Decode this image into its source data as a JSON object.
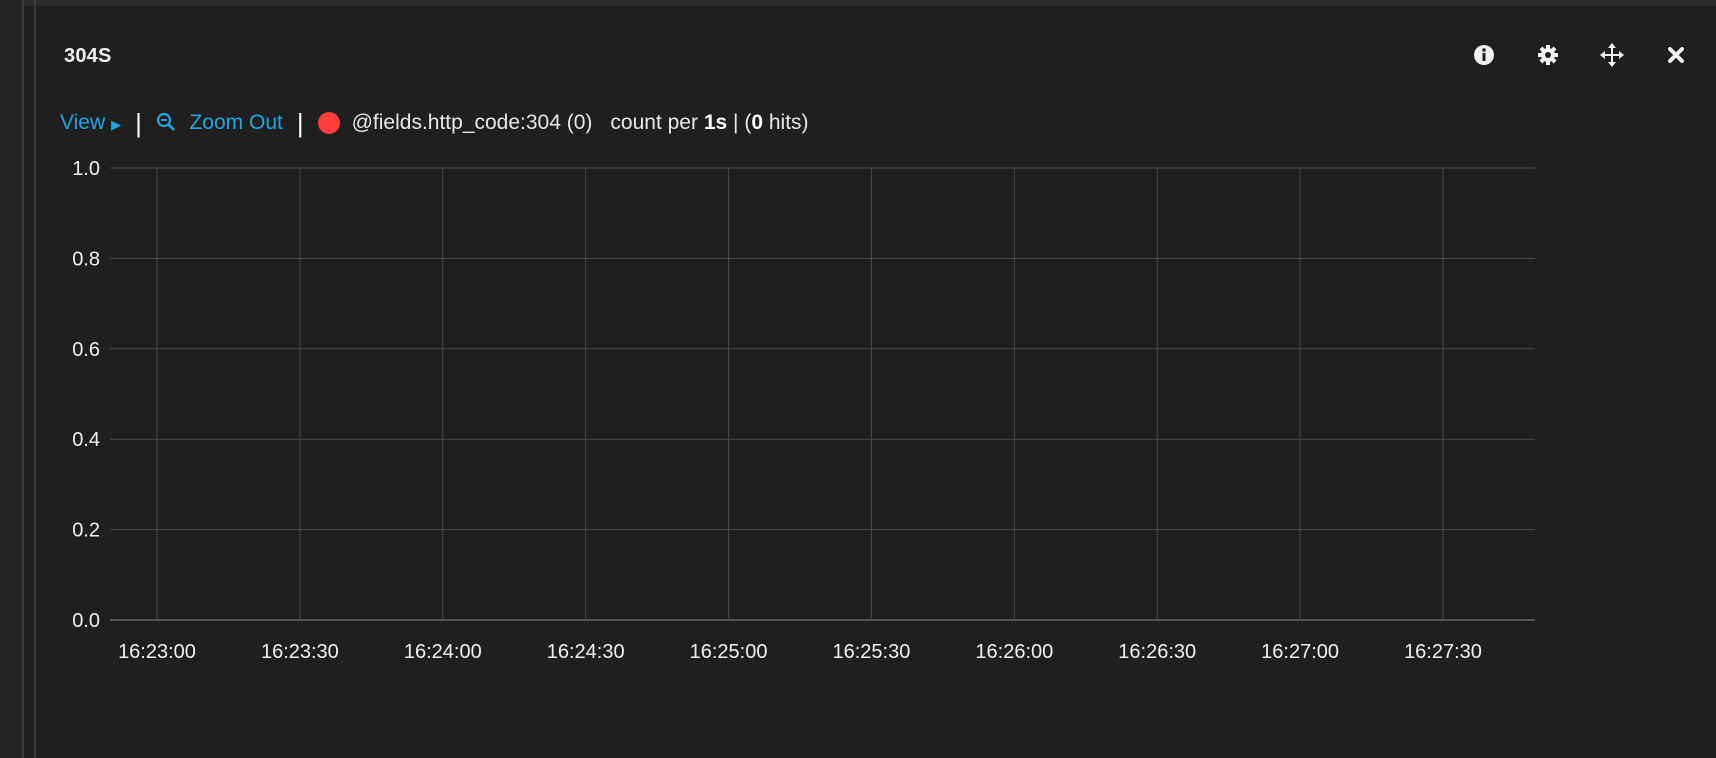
{
  "panel": {
    "title": "304S",
    "icons": [
      "info-icon",
      "gear-icon",
      "move-icon",
      "close-icon"
    ]
  },
  "toolbar": {
    "view_label": "View",
    "zoom_out_label": "Zoom Out"
  },
  "legend": {
    "series_label": "@fields.http_code:304 (0)",
    "count_prefix": "count per",
    "interval": "1s",
    "separator": "|",
    "hits_open": "(",
    "hits_value": "0",
    "hits_suffix": "hits)",
    "dot_color": "#ff3b3b"
  },
  "colors": {
    "accent": "#21a6e4",
    "background": "#1f1f1f",
    "series": "#ff3b3b"
  },
  "chart_data": {
    "type": "line",
    "title": "",
    "xlabel": "",
    "ylabel": "",
    "x_ticks": [
      "16:23:00",
      "16:23:30",
      "16:24:00",
      "16:24:30",
      "16:25:00",
      "16:25:30",
      "16:26:00",
      "16:26:30",
      "16:27:00",
      "16:27:30"
    ],
    "y_ticks": [
      "0.0",
      "0.2",
      "0.4",
      "0.6",
      "0.8",
      "1.0"
    ],
    "ylim": [
      0,
      1
    ],
    "grid": true,
    "series": []
  }
}
